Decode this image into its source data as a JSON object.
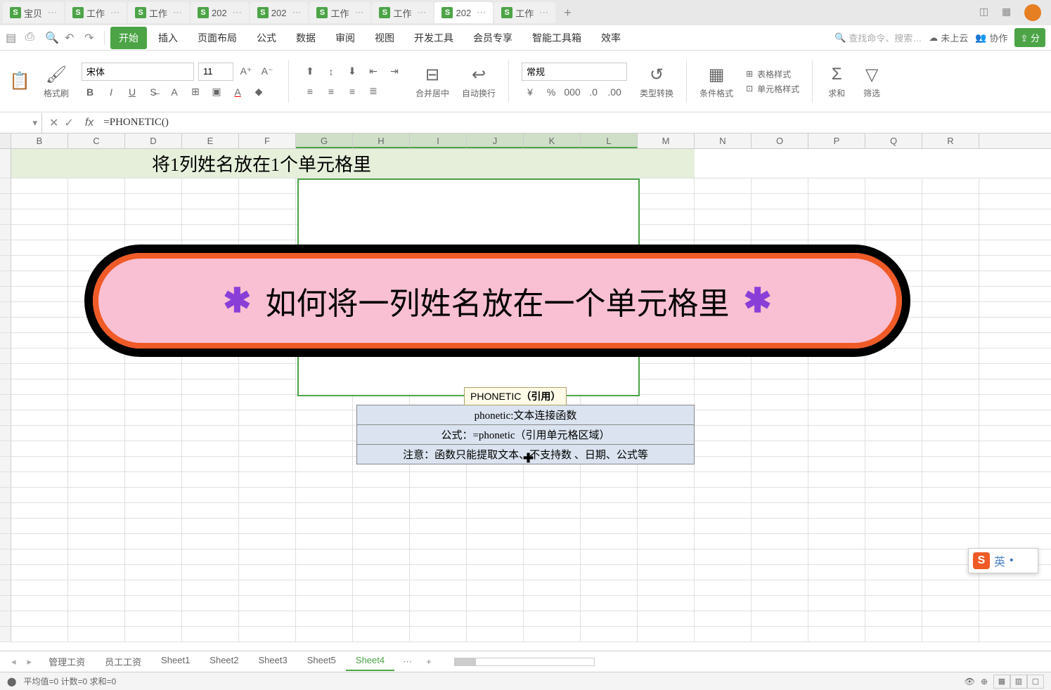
{
  "tabs": [
    {
      "label": "宝贝"
    },
    {
      "label": "工作"
    },
    {
      "label": "工作"
    },
    {
      "label": "202"
    },
    {
      "label": "202"
    },
    {
      "label": "工作"
    },
    {
      "label": "工作"
    },
    {
      "label": "202",
      "active": true
    },
    {
      "label": "工作"
    }
  ],
  "menu": {
    "items": [
      "开始",
      "插入",
      "页面布局",
      "公式",
      "数据",
      "审阅",
      "视图",
      "开发工具",
      "会员专享",
      "智能工具箱",
      "效率"
    ],
    "active": "开始",
    "search_placeholder": "查找命令、搜索…",
    "cloud": "未上云",
    "collab": "协作",
    "share": "分"
  },
  "ribbon": {
    "paste": "格式刷",
    "font_name": "宋体",
    "font_size": "11",
    "merge": "合并居中",
    "wrap": "自动换行",
    "number_format": "常规",
    "type_convert": "类型转换",
    "cond_format": "条件格式",
    "table_style": "表格样式",
    "cell_style": "单元格样式",
    "sum": "求和",
    "filter": "筛选"
  },
  "formula_bar": {
    "formula": "=PHONETIC()"
  },
  "columns": [
    "B",
    "C",
    "D",
    "E",
    "F",
    "G",
    "H",
    "I",
    "J",
    "K",
    "L",
    "M",
    "N",
    "O",
    "P",
    "Q",
    "R"
  ],
  "selected_cols": [
    "G",
    "H",
    "I",
    "J",
    "K",
    "L"
  ],
  "cells": {
    "title": "将1列姓名放在1个单元格里"
  },
  "tooltip": {
    "func": "PHONETIC",
    "arg": "（引用）"
  },
  "infobox": {
    "r1": "phonetic:文本连接函数",
    "r2": "公式：=phonetic（引用单元格区域）",
    "r3": "注意：函数只能提取文本、不支持数    、日期、公式等"
  },
  "banner": {
    "text": "如何将一列姓名放在一个单元格里",
    "ast": "✱"
  },
  "ime": {
    "icon": "S",
    "text": "英"
  },
  "sheet_tabs": [
    "管理工资",
    "员工工资",
    "Sheet1",
    "Sheet2",
    "Sheet3",
    "Sheet5",
    "Sheet4"
  ],
  "active_sheet": "Sheet4",
  "status": {
    "left": "平均值=0  计数=0  求和=0"
  }
}
